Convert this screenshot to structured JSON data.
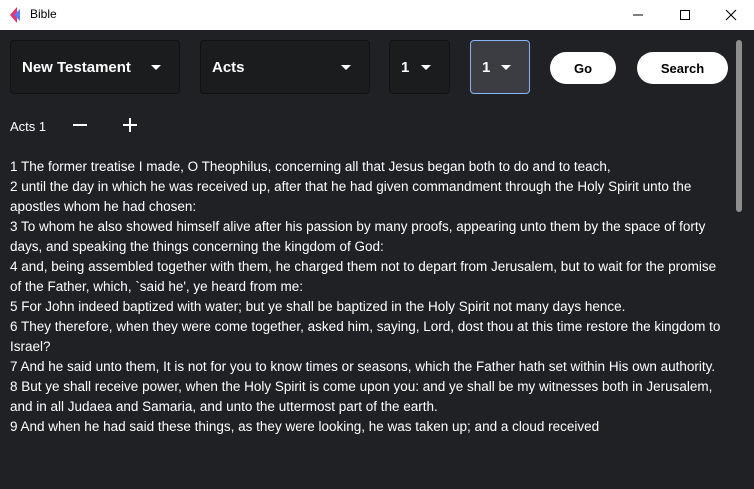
{
  "window": {
    "title": "Bible",
    "controls": [
      "minimize-icon",
      "maximize-icon",
      "close-icon"
    ]
  },
  "toolbar": {
    "testament": "New Testament",
    "book": "Acts",
    "chapter": "1",
    "verse": "1",
    "go_label": "Go",
    "search_label": "Search"
  },
  "chapter_bar": {
    "label": "Acts 1",
    "minus_icon": "minus-icon",
    "plus_icon": "plus-icon"
  },
  "verses": [
    "1 The former treatise I made, O Theophilus, concerning all that Jesus began both to do and to teach,",
    "2 until the day in which he was received up, after that he had given commandment through the Holy Spirit unto the apostles whom he had chosen:",
    "3 To whom he also showed himself alive after his passion by many proofs, appearing unto them by the space of forty days, and speaking the things concerning the kingdom of God:",
    "4 and, being assembled together with them, he charged them not to depart from Jerusalem, but to wait for the promise of the Father, which, `said he', ye heard from me:",
    "5 For John indeed baptized with water; but ye shall be baptized in the Holy Spirit not many days hence.",
    "6 They therefore, when they were come together, asked him, saying, Lord, dost thou at this time restore the kingdom to Israel?",
    "7 And he said unto them, It is not for you to know times or seasons, which the Father hath set within His own authority.",
    "8 But ye shall receive power, when the Holy Spirit is come upon you: and ye shall be my witnesses both in Jerusalem, and in all Judaea and Samaria, and unto the uttermost part of the earth.",
    "9 And when he had said these things, as they were looking, he was taken up; and a cloud received"
  ]
}
